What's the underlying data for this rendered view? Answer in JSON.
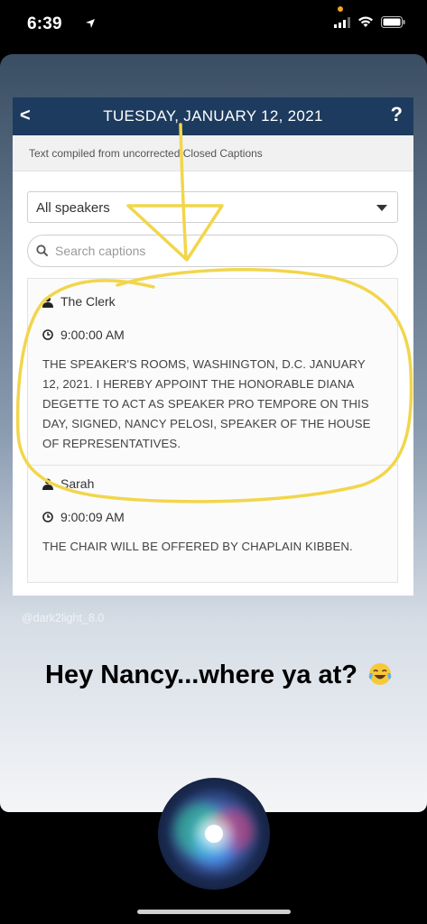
{
  "status_bar": {
    "time": "6:39"
  },
  "screenshot": {
    "header_title": "TUESDAY, JANUARY 12, 2021",
    "back_label": "<",
    "help_label": "?",
    "subtitle": "Text compiled from uncorrected Closed Captions",
    "speaker_filter": "All speakers",
    "search_placeholder": "Search captions",
    "entries": [
      {
        "speaker": "The Clerk",
        "time": "9:00:00 AM",
        "text": "THE SPEAKER'S ROOMS, WASHINGTON, D.C. JANUARY 12, 2021. I HEREBY APPOINT THE HONORABLE DIANA DEGETTE TO ACT AS SPEAKER PRO TEMPORE ON THIS DAY, SIGNED, NANCY PELOSI, SPEAKER OF THE HOUSE OF REPRESENTATIVES."
      },
      {
        "speaker": "Sarah",
        "time": "9:00:09 AM",
        "text": "THE CHAIR WILL BE OFFERED BY CHAPLAIN KIBBEN."
      }
    ]
  },
  "story": {
    "handle": "@dark2light_8.0",
    "caption": "Hey Nancy...where ya at?",
    "emoji": "face-with-tears-of-joy"
  },
  "colors": {
    "header": "#1d3b5e",
    "annotation": "#f2d64b"
  }
}
